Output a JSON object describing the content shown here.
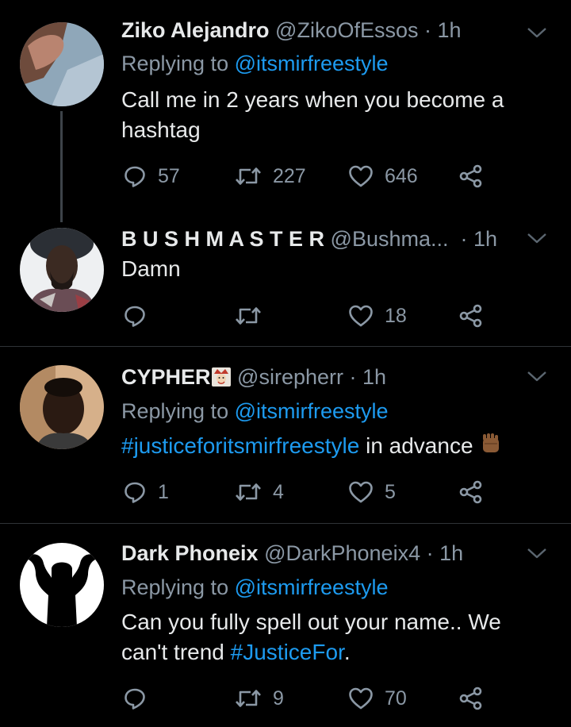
{
  "theme": {
    "background": "#000000",
    "primary_text": "#e7e9ea",
    "secondary_text": "#8b98a5",
    "link": "#1d9bf0",
    "divider": "#2f3336",
    "thread_line": "#3d4349"
  },
  "tweets": [
    {
      "display_name": "Ziko Alejandro",
      "handle": "@ZikoOfEssos",
      "time": "1h",
      "replying_prefix": "Replying to ",
      "replying_to": "@itsmirfreestyle",
      "text": "Call me in 2 years when you become a hashtag",
      "reply_count": "57",
      "retweet_count": "227",
      "like_count": "646"
    },
    {
      "display_name": "B U S H M A S T E R",
      "handle": "@Bushma...",
      "time": "1h",
      "text": "Damn",
      "reply_count": "",
      "retweet_count": "",
      "like_count": "18"
    },
    {
      "display_name": "CYPHER",
      "handle": "@sirepherr",
      "time": "1h",
      "replying_prefix": "Replying to ",
      "replying_to": "@itsmirfreestyle",
      "hashtag": "#justiceforitsmirfreestyle",
      "text_after": " in advance",
      "reply_count": "1",
      "retweet_count": "4",
      "like_count": "5"
    },
    {
      "display_name": "Dark Phoneix",
      "handle": "@DarkPhoneix4",
      "time": "1h",
      "replying_prefix": "Replying to ",
      "replying_to": "@itsmirfreestyle",
      "text_line1": "Can you fully spell out your name.. We",
      "text_line2_before": "can't trend ",
      "hashtag": "#JusticeFor",
      "text_line2_after": ".",
      "reply_count": "",
      "retweet_count": "9",
      "like_count": "70"
    }
  ]
}
